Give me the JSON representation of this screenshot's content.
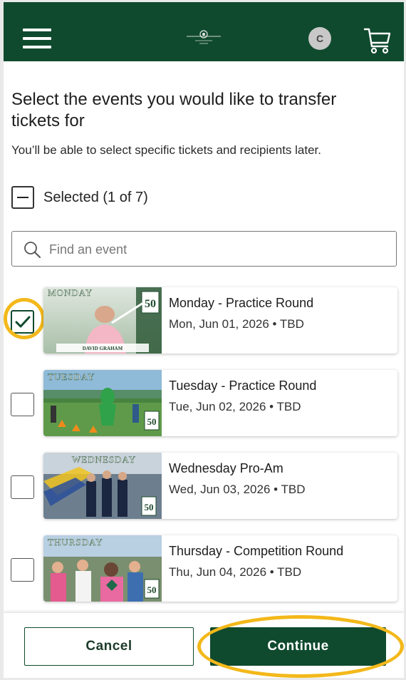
{
  "header": {
    "avatar_initial": "C"
  },
  "main": {
    "title": "Select the events you would like to transfer tickets for",
    "subtitle": "You’ll be able to select specific tickets and recipients later.",
    "selected_label": "Selected (1 of 7)",
    "search_placeholder": "Find an event"
  },
  "events": [
    {
      "name": "Monday - Practice Round",
      "date": "Mon, Jun 01, 2026 • TBD",
      "checked": true,
      "banner": "MONDAY",
      "caption": "DAVID GRAHAM"
    },
    {
      "name": "Tuesday - Practice Round",
      "date": "Tue, Jun 02, 2026 • TBD",
      "checked": false,
      "banner": "TUESDAY"
    },
    {
      "name": "Wednesday Pro-Am",
      "date": "Wed, Jun 03, 2026 • TBD",
      "checked": false,
      "banner": "WEDNESDAY"
    },
    {
      "name": "Thursday - Competition Round",
      "date": "Thu, Jun 04, 2026 • TBD",
      "checked": false,
      "banner": "THURSDAY"
    }
  ],
  "footer": {
    "cancel_label": "Cancel",
    "continue_label": "Continue"
  },
  "colors": {
    "brand_green": "#0f4a2e",
    "highlight": "#f3b81a"
  }
}
